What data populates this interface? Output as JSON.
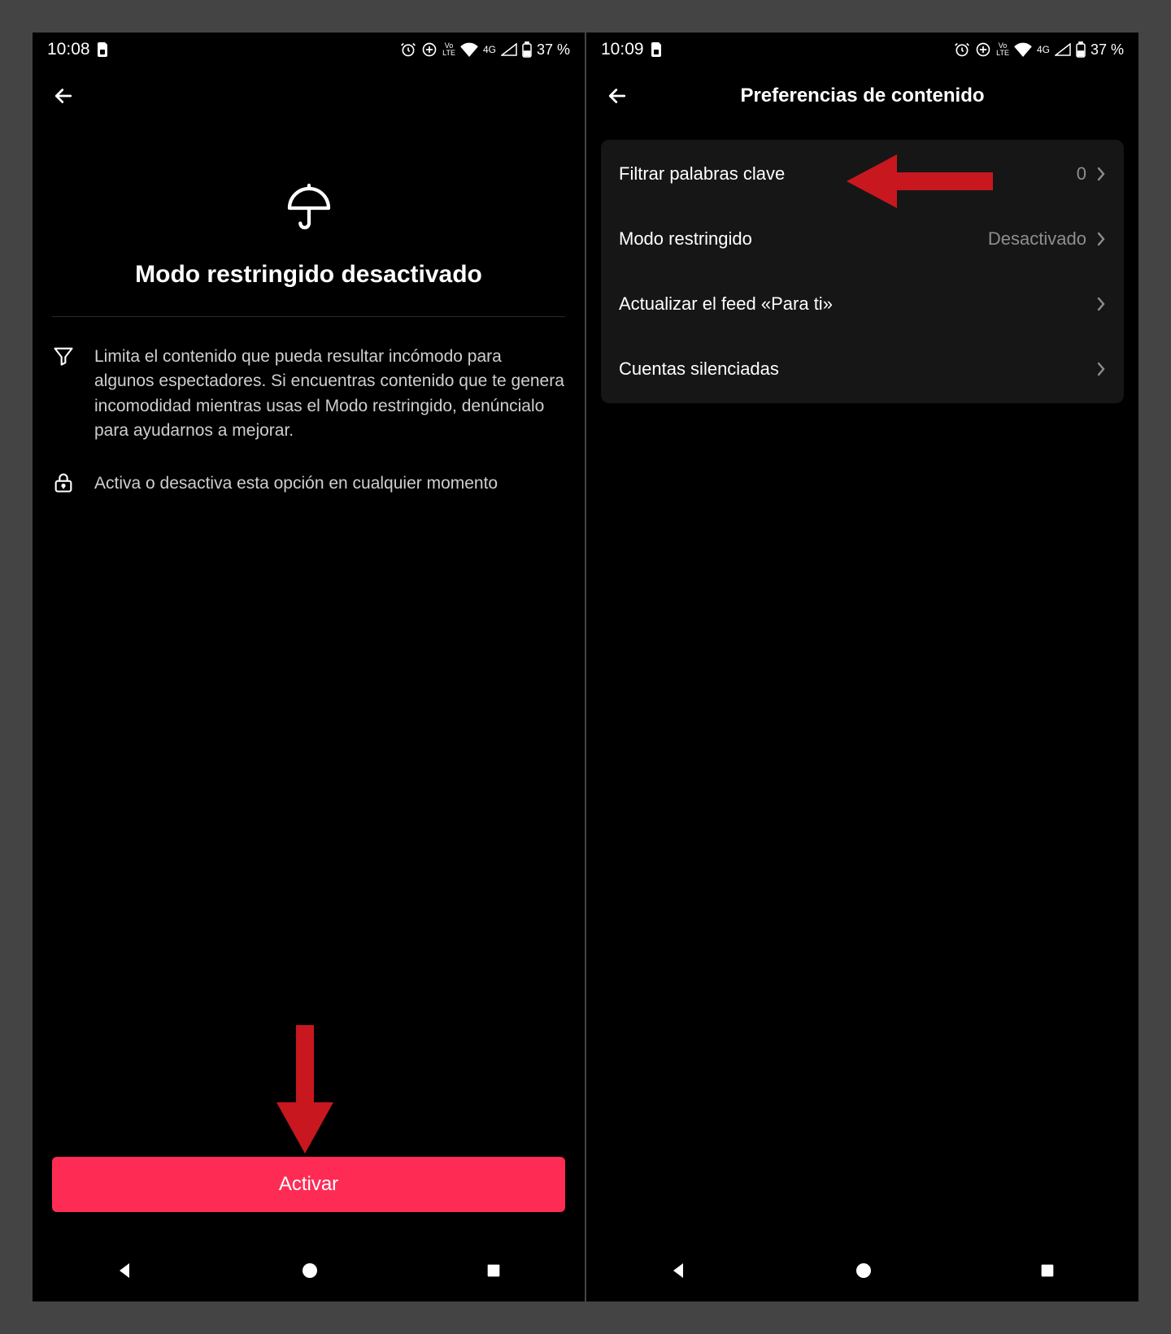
{
  "screen1": {
    "statusbar": {
      "time": "10:08",
      "network_badge": "4G",
      "battery_text": "37 %"
    },
    "title": "Modo restringido desactivado",
    "desc_filter": "Limita el contenido que pueda resultar incómodo para algunos espectadores. Si encuentras contenido que te genera incomodidad mientras usas el Modo restringido, denúncialo para ayudarnos a mejorar.",
    "desc_lock": "Activa o desactiva esta opción en cualquier momento",
    "activate_label": "Activar"
  },
  "screen2": {
    "statusbar": {
      "time": "10:09",
      "network_badge": "4G",
      "battery_text": "37 %"
    },
    "header_title": "Preferencias de contenido",
    "rows": [
      {
        "label": "Filtrar palabras clave",
        "value": "0"
      },
      {
        "label": "Modo restringido",
        "value": "Desactivado"
      },
      {
        "label": "Actualizar el feed «Para ti»",
        "value": ""
      },
      {
        "label": "Cuentas silenciadas",
        "value": ""
      }
    ]
  },
  "colors": {
    "accent": "#fe2c55",
    "arrow": "#c8171e"
  }
}
